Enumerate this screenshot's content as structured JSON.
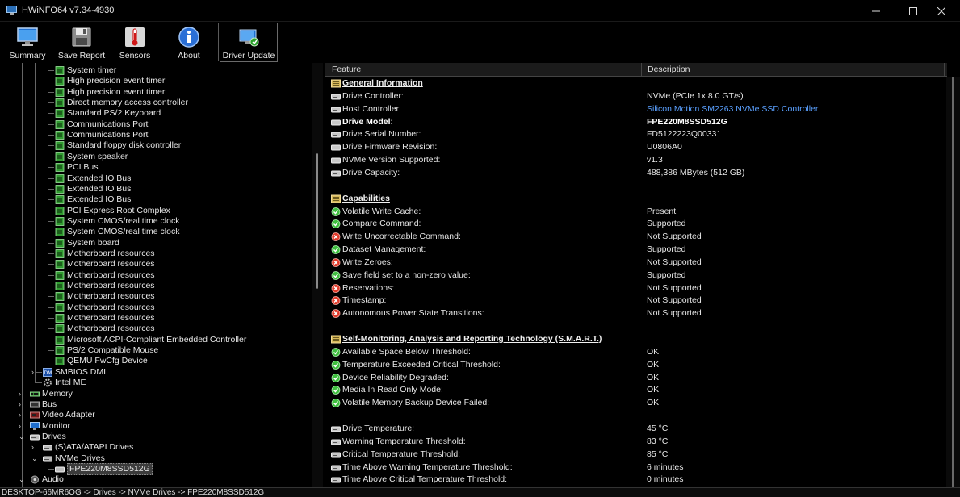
{
  "window": {
    "title": "HWiNFO64 v7.34-4930"
  },
  "toolbar": {
    "buttons": [
      {
        "label": "Summary",
        "icon": "monitor-icon"
      },
      {
        "label": "Save Report",
        "icon": "floppy-disk-icon"
      },
      {
        "label": "Sensors",
        "icon": "thermometer-icon"
      },
      {
        "label": "About",
        "icon": "info-icon"
      },
      {
        "label": "Driver Update",
        "icon": "driver-update-icon"
      }
    ]
  },
  "tree": {
    "device_items": [
      "System timer",
      "High precision event timer",
      "High precision event timer",
      "Direct memory access controller",
      "Standard PS/2 Keyboard",
      "Communications Port",
      "Communications Port",
      "Standard floppy disk controller",
      "System speaker",
      "PCI Bus",
      "Extended IO Bus",
      "Extended IO Bus",
      "Extended IO Bus",
      "PCI Express Root Complex",
      "System CMOS/real time clock",
      "System CMOS/real time clock",
      "System board",
      "Motherboard resources",
      "Motherboard resources",
      "Motherboard resources",
      "Motherboard resources",
      "Motherboard resources",
      "Motherboard resources",
      "Motherboard resources",
      "Motherboard resources",
      "Microsoft ACPI-Compliant Embedded Controller",
      "PS/2 Compatible Mouse",
      "QEMU FwCfg Device"
    ],
    "smbios": "SMBIOS DMI",
    "intel_me": "Intel ME",
    "categories": [
      "Memory",
      "Bus",
      "Video Adapter",
      "Monitor",
      "Drives"
    ],
    "drives_children": [
      "(S)ATA/ATAPI Drives",
      "NVMe Drives"
    ],
    "selected_drive": "FPE220M8SSD512G",
    "audio": "Audio"
  },
  "table": {
    "col_feature": "Feature",
    "col_description": "Description",
    "sections": {
      "general": "General Information",
      "capabilities": "Capabilities",
      "smart": "Self-Monitoring, Analysis and Reporting Technology (S.M.A.R.T.)"
    },
    "general_rows": [
      {
        "feature": "Drive Controller:",
        "desc": "NVMe (PCIe 1x 8.0 GT/s)"
      },
      {
        "feature": "Host Controller:",
        "desc": "Silicon Motion SM2263 NVMe SSD Controller"
      },
      {
        "feature": "Drive Model:",
        "desc": "FPE220M8SSD512G"
      },
      {
        "feature": "Drive Serial Number:",
        "desc": "FD5122223Q00331"
      },
      {
        "feature": "Drive Firmware Revision:",
        "desc": "U0806A0"
      },
      {
        "feature": "NVMe Version Supported:",
        "desc": "v1.3"
      },
      {
        "feature": "Drive Capacity:",
        "desc": "488,386 MBytes (512 GB)"
      }
    ],
    "capability_rows": [
      {
        "feature": "Volatile Write Cache:",
        "desc": "Present",
        "status": "ok"
      },
      {
        "feature": "Compare Command:",
        "desc": "Supported",
        "status": "ok"
      },
      {
        "feature": "Write Uncorrectable Command:",
        "desc": "Not Supported",
        "status": "no"
      },
      {
        "feature": "Dataset Management:",
        "desc": "Supported",
        "status": "ok"
      },
      {
        "feature": "Write Zeroes:",
        "desc": "Not Supported",
        "status": "no"
      },
      {
        "feature": "Save field set to a non-zero value:",
        "desc": "Supported",
        "status": "ok"
      },
      {
        "feature": "Reservations:",
        "desc": "Not Supported",
        "status": "no"
      },
      {
        "feature": "Timestamp:",
        "desc": "Not Supported",
        "status": "no"
      },
      {
        "feature": "Autonomous Power State Transitions:",
        "desc": "Not Supported",
        "status": "no"
      }
    ],
    "smart_rows": [
      {
        "feature": "Available Space Below Threshold:",
        "desc": "OK"
      },
      {
        "feature": "Temperature Exceeded Critical Threshold:",
        "desc": "OK"
      },
      {
        "feature": "Device Reliability Degraded:",
        "desc": "OK"
      },
      {
        "feature": "Media In Read Only Mode:",
        "desc": "OK"
      },
      {
        "feature": "Volatile Memory Backup Device Failed:",
        "desc": "OK"
      }
    ],
    "temp_rows": [
      {
        "feature": "Drive Temperature:",
        "desc": "45 °C"
      },
      {
        "feature": "Warning Temperature Threshold:",
        "desc": "83 °C"
      },
      {
        "feature": "Critical Temperature Threshold:",
        "desc": "85 °C"
      },
      {
        "feature": "Time Above Warning Temperature Threshold:",
        "desc": "6 minutes"
      },
      {
        "feature": "Time Above Critical Temperature Threshold:",
        "desc": "0 minutes"
      }
    ]
  },
  "status": {
    "text": "DESKTOP-66MR6OG -> Drives -> NVMe Drives -> FPE220M8SSD512G"
  },
  "colors": {
    "link": "#5aa0ff",
    "ok": "#3fbf3f",
    "error": "#e03a2a"
  }
}
